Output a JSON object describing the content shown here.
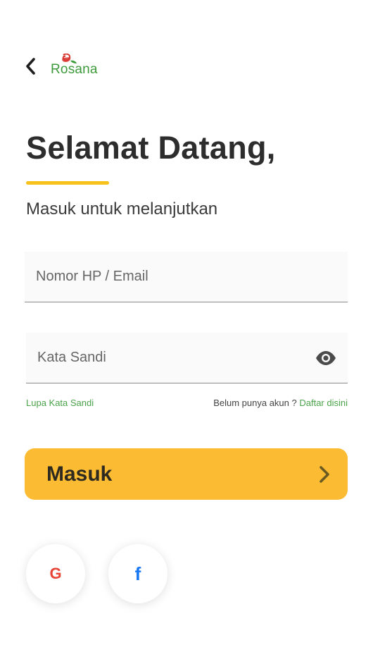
{
  "header": {
    "logo_text": "Rosana",
    "colors": {
      "logo_green": "#3d9a3a",
      "logo_red": "#d8342e"
    }
  },
  "welcome": {
    "title": "Selamat Datang,",
    "subtitle": "Masuk untuk melanjutkan",
    "accent_color": "#f6c21b"
  },
  "form": {
    "phone_email": {
      "placeholder": "Nomor HP / Email",
      "value": ""
    },
    "password": {
      "placeholder": "Kata Sandi",
      "value": "",
      "toggle_icon": "eye-icon"
    },
    "forgot_link": "Lupa Kata Sandi",
    "no_account_text": "Belum punya akun ?",
    "register_link": "Daftar disini"
  },
  "login_button": {
    "label": "Masuk",
    "color": "#fbbc33",
    "icon": "chevron-right-icon"
  },
  "social_login": [
    {
      "name": "google",
      "glyph": "G",
      "color": "#e84335"
    },
    {
      "name": "facebook",
      "glyph": "f",
      "color": "#1877f2"
    }
  ]
}
